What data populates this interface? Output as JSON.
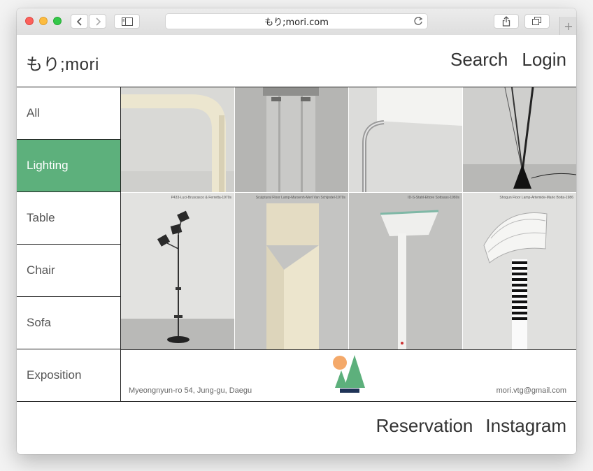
{
  "browser": {
    "address": "もり;mori.com",
    "back_icon": "chevron-left-icon",
    "forward_icon": "chevron-right-icon",
    "sidebar_icon": "sidebar-icon",
    "reload_icon": "reload-icon",
    "share_icon": "share-icon",
    "tabs_icon": "tabs-icon",
    "new_tab_label": "+"
  },
  "site": {
    "logo": "もり;mori",
    "nav": {
      "search": "Search",
      "login": "Login"
    }
  },
  "sidebar": {
    "items": [
      {
        "label": "All"
      },
      {
        "label": "Lighting"
      },
      {
        "label": "Table"
      },
      {
        "label": "Chair"
      },
      {
        "label": "Sofa"
      },
      {
        "label": "Exposition"
      }
    ],
    "active_color": "#5db07c"
  },
  "products": [
    {
      "caption": "P433-Luci-Bruscasco & Ferretta-1970s"
    },
    {
      "caption": "Sculptural Floor Lamp-Marsenh-Merl Van Schijndel-1970s"
    },
    {
      "caption": "ID-S-Stahl-Ettore Sottsass-1980s"
    },
    {
      "caption": "Shogun Floor Lamp-Artemide-Mario Botta-1986"
    }
  ],
  "footer": {
    "address": "Myeongnyun-ro 54, Jung-gu, Daegu",
    "email": "mori.vtg@gmail.com",
    "emblem_colors": {
      "sun": "#f4a96a",
      "tree": "#5db07c",
      "base": "#1f3357"
    }
  },
  "bottom_nav": {
    "reservation": "Reservation",
    "instagram": "Instagram"
  }
}
